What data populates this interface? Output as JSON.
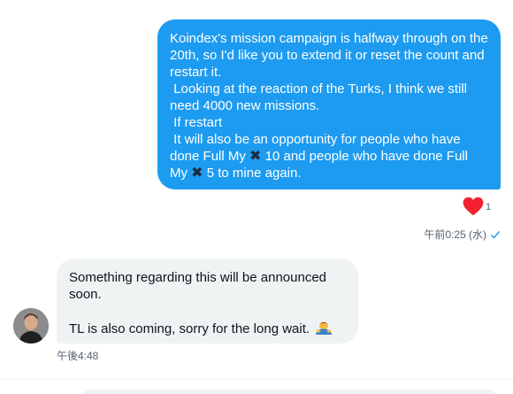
{
  "sent_message": {
    "text_before_1": "Koindex's mission campaign is halfway through on the 20th, so I'd like you to extend it or reset the count and restart it.\n Looking at the reaction of the Turks, I think we still need 4000 new missions.\n If restart\n It will also be an opportunity for people who have done Full My ",
    "text_after_1": " 10 and people who have done Full My ",
    "text_after_2": " 5 to mine again.",
    "inline_icon": "heavy-multiplication-x-icon",
    "reaction": {
      "icon": "heart-icon",
      "color": "#f4212e",
      "count": "1"
    },
    "timestamp": "午前0:25 (水)",
    "status_icon": "check-icon"
  },
  "received_message": {
    "line_1": "Something regarding this will be announced soon.",
    "line_2": "TL is also coming, sorry for the long wait. ",
    "emoji_icon": "person-bowing-emoji-icon",
    "timestamp": "午後4:48"
  },
  "colors": {
    "sent_bubble": "#1d9bf0",
    "received_bubble": "#eff3f4",
    "meta_text": "#536471",
    "accent": "#1d9bf0"
  }
}
